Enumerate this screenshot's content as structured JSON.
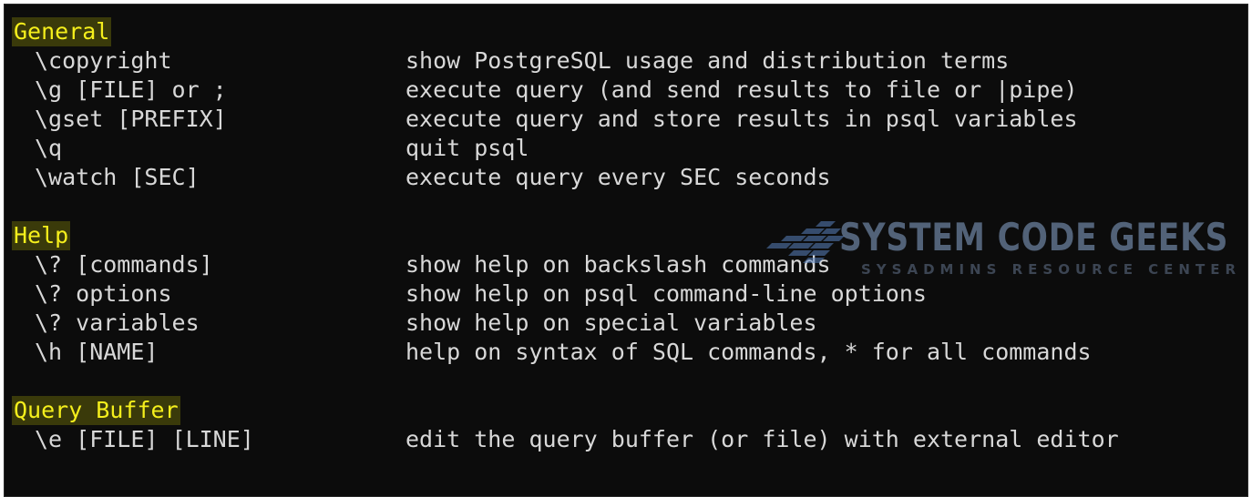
{
  "sections": [
    {
      "title": "General",
      "rows": [
        {
          "cmd": "\\copyright",
          "desc": "show PostgreSQL usage and distribution terms"
        },
        {
          "cmd": "\\g [FILE] or ;",
          "desc": "execute query (and send results to file or |pipe)"
        },
        {
          "cmd": "\\gset [PREFIX]",
          "desc": "execute query and store results in psql variables"
        },
        {
          "cmd": "\\q",
          "desc": "quit psql"
        },
        {
          "cmd": "\\watch [SEC]",
          "desc": "execute query every SEC seconds"
        }
      ]
    },
    {
      "title": "Help",
      "rows": [
        {
          "cmd": "\\? [commands]",
          "desc": "show help on backslash commands"
        },
        {
          "cmd": "\\? options",
          "desc": "show help on psql command-line options"
        },
        {
          "cmd": "\\? variables",
          "desc": "show help on special variables"
        },
        {
          "cmd": "\\h [NAME]",
          "desc": "help on syntax of SQL commands, * for all commands"
        }
      ]
    },
    {
      "title": "Query Buffer",
      "rows": [
        {
          "cmd": "\\e [FILE] [LINE]",
          "desc": "edit the query buffer (or file) with external editor"
        }
      ]
    }
  ],
  "watermark": {
    "title": "SYSTEM CODE GEEKS",
    "subtitle": "SYSADMINS RESOURCE CENTER",
    "icon": "arrow-lines-logo-icon"
  },
  "colors": {
    "background": "#0c0c0c",
    "text": "#cccccc",
    "section_highlight_text": "#f5ef1c",
    "section_highlight_bg": "#3a3a0a"
  }
}
